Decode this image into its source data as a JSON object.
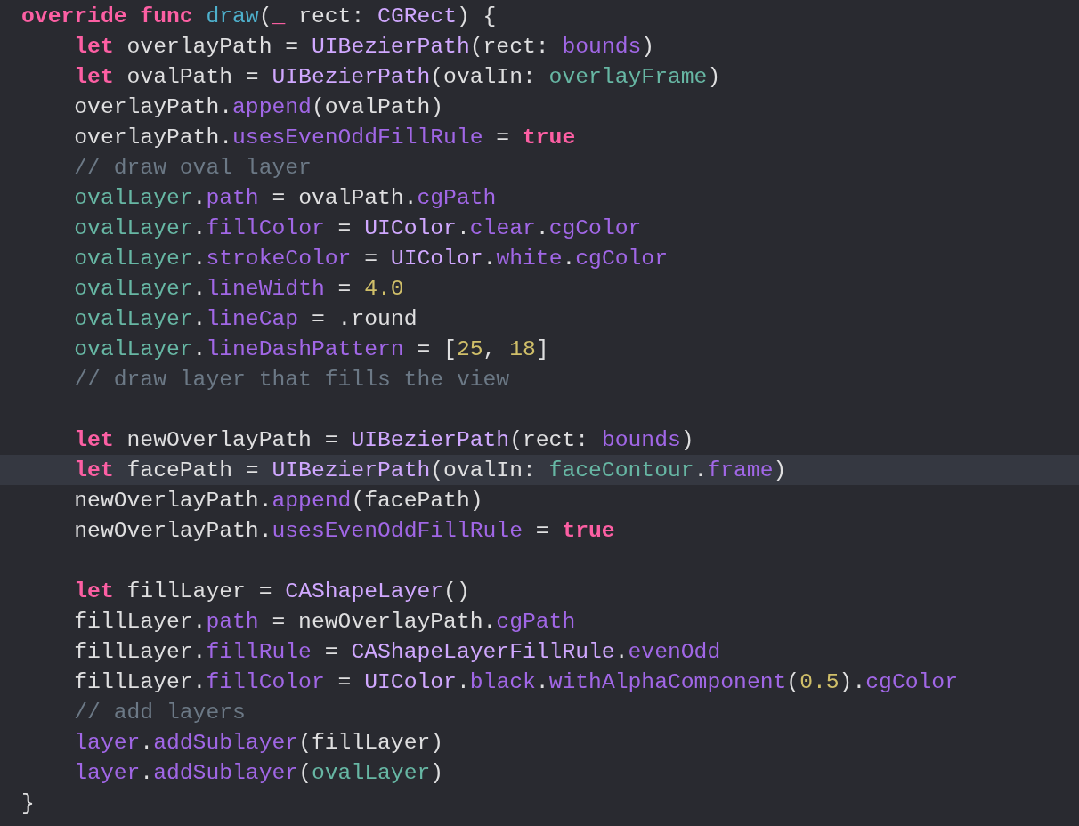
{
  "editor": {
    "lines": [
      {
        "current": false,
        "tokens": [
          {
            "text": "override func ",
            "kind": "keyword"
          },
          {
            "text": "draw",
            "kind": "decl"
          },
          {
            "text": "(",
            "kind": "plain"
          },
          {
            "text": "_",
            "kind": "keyword"
          },
          {
            "text": " rect: ",
            "kind": "plain"
          },
          {
            "text": "CGRect",
            "kind": "type"
          },
          {
            "text": ") {",
            "kind": "plain"
          }
        ],
        "children": [
          {
            "current": false,
            "tokens": [
              {
                "text": "let",
                "kind": "keyword"
              },
              {
                "text": " overlayPath = ",
                "kind": "plain"
              },
              {
                "text": "UIBezierPath",
                "kind": "type"
              },
              {
                "text": "(rect: ",
                "kind": "plain"
              },
              {
                "text": "bounds",
                "kind": "member"
              },
              {
                "text": ")",
                "kind": "plain"
              }
            ]
          },
          {
            "current": false,
            "tokens": [
              {
                "text": "let",
                "kind": "keyword"
              },
              {
                "text": " ovalPath = ",
                "kind": "plain"
              },
              {
                "text": "UIBezierPath",
                "kind": "type"
              },
              {
                "text": "(ovalIn: ",
                "kind": "plain"
              },
              {
                "text": "overlayFrame",
                "kind": "project"
              },
              {
                "text": ")",
                "kind": "plain"
              }
            ]
          },
          {
            "current": false,
            "tokens": [
              {
                "text": "overlayPath.",
                "kind": "plain"
              },
              {
                "text": "append",
                "kind": "member"
              },
              {
                "text": "(ovalPath)",
                "kind": "plain"
              }
            ]
          },
          {
            "current": false,
            "tokens": [
              {
                "text": "overlayPath.",
                "kind": "plain"
              },
              {
                "text": "usesEvenOddFillRule",
                "kind": "member"
              },
              {
                "text": " = ",
                "kind": "plain"
              },
              {
                "text": "true",
                "kind": "keyword"
              }
            ]
          },
          {
            "current": false,
            "tokens": [
              {
                "text": "// draw oval layer",
                "kind": "comment"
              }
            ]
          },
          {
            "current": false,
            "tokens": [
              {
                "text": "ovalLayer",
                "kind": "project"
              },
              {
                "text": ".",
                "kind": "plain"
              },
              {
                "text": "path",
                "kind": "member"
              },
              {
                "text": " = ovalPath.",
                "kind": "plain"
              },
              {
                "text": "cgPath",
                "kind": "member"
              }
            ]
          },
          {
            "current": false,
            "tokens": [
              {
                "text": "ovalLayer",
                "kind": "project"
              },
              {
                "text": ".",
                "kind": "plain"
              },
              {
                "text": "fillColor",
                "kind": "member"
              },
              {
                "text": " = ",
                "kind": "plain"
              },
              {
                "text": "UIColor",
                "kind": "type"
              },
              {
                "text": ".",
                "kind": "plain"
              },
              {
                "text": "clear",
                "kind": "member"
              },
              {
                "text": ".",
                "kind": "plain"
              },
              {
                "text": "cgColor",
                "kind": "member"
              }
            ]
          },
          {
            "current": false,
            "tokens": [
              {
                "text": "ovalLayer",
                "kind": "project"
              },
              {
                "text": ".",
                "kind": "plain"
              },
              {
                "text": "strokeColor",
                "kind": "member"
              },
              {
                "text": " = ",
                "kind": "plain"
              },
              {
                "text": "UIColor",
                "kind": "type"
              },
              {
                "text": ".",
                "kind": "plain"
              },
              {
                "text": "white",
                "kind": "member"
              },
              {
                "text": ".",
                "kind": "plain"
              },
              {
                "text": "cgColor",
                "kind": "member"
              }
            ]
          },
          {
            "current": false,
            "tokens": [
              {
                "text": "ovalLayer",
                "kind": "project"
              },
              {
                "text": ".",
                "kind": "plain"
              },
              {
                "text": "lineWidth",
                "kind": "member"
              },
              {
                "text": " = ",
                "kind": "plain"
              },
              {
                "text": "4.0",
                "kind": "number"
              }
            ]
          },
          {
            "current": false,
            "tokens": [
              {
                "text": "ovalLayer",
                "kind": "project"
              },
              {
                "text": ".",
                "kind": "plain"
              },
              {
                "text": "lineCap",
                "kind": "member"
              },
              {
                "text": " = .round",
                "kind": "plain"
              }
            ]
          },
          {
            "current": false,
            "tokens": [
              {
                "text": "ovalLayer",
                "kind": "project"
              },
              {
                "text": ".",
                "kind": "plain"
              },
              {
                "text": "lineDashPattern",
                "kind": "member"
              },
              {
                "text": " = [",
                "kind": "plain"
              },
              {
                "text": "25",
                "kind": "number"
              },
              {
                "text": ", ",
                "kind": "plain"
              },
              {
                "text": "18",
                "kind": "number"
              },
              {
                "text": "]",
                "kind": "plain"
              }
            ]
          },
          {
            "current": false,
            "tokens": [
              {
                "text": "// draw layer that fills the view",
                "kind": "comment"
              }
            ]
          },
          {
            "current": false
          },
          {
            "current": false,
            "tokens": [
              {
                "text": "let",
                "kind": "keyword"
              },
              {
                "text": " newOverlayPath = ",
                "kind": "plain"
              },
              {
                "text": "UIBezierPath",
                "kind": "type"
              },
              {
                "text": "(rect: ",
                "kind": "plain"
              },
              {
                "text": "bounds",
                "kind": "member"
              },
              {
                "text": ")",
                "kind": "plain"
              }
            ]
          },
          {
            "current": true,
            "tokens": [
              {
                "text": "let",
                "kind": "keyword"
              },
              {
                "text": " facePath = ",
                "kind": "plain"
              },
              {
                "text": "UIBezierPath",
                "kind": "type"
              },
              {
                "text": "(ovalIn: ",
                "kind": "plain"
              },
              {
                "text": "faceContour",
                "kind": "project"
              },
              {
                "text": ".",
                "kind": "plain"
              },
              {
                "text": "frame",
                "kind": "member"
              },
              {
                "text": ")",
                "kind": "plain"
              }
            ]
          },
          {
            "current": false,
            "tokens": [
              {
                "text": "newOverlayPath.",
                "kind": "plain"
              },
              {
                "text": "append",
                "kind": "member"
              },
              {
                "text": "(facePath)",
                "kind": "plain"
              }
            ]
          },
          {
            "current": false,
            "tokens": [
              {
                "text": "newOverlayPath.",
                "kind": "plain"
              },
              {
                "text": "usesEvenOddFillRule",
                "kind": "member"
              },
              {
                "text": " = ",
                "kind": "plain"
              },
              {
                "text": "true",
                "kind": "keyword"
              }
            ]
          },
          {
            "current": false
          },
          {
            "current": false,
            "tokens": [
              {
                "text": "let",
                "kind": "keyword"
              },
              {
                "text": " fillLayer = ",
                "kind": "plain"
              },
              {
                "text": "CAShapeLayer",
                "kind": "type"
              },
              {
                "text": "()",
                "kind": "plain"
              }
            ]
          },
          {
            "current": false,
            "tokens": [
              {
                "text": "fillLayer.",
                "kind": "plain"
              },
              {
                "text": "path",
                "kind": "member"
              },
              {
                "text": " = newOverlayPath.",
                "kind": "plain"
              },
              {
                "text": "cgPath",
                "kind": "member"
              }
            ]
          },
          {
            "current": false,
            "tokens": [
              {
                "text": "fillLayer.",
                "kind": "plain"
              },
              {
                "text": "fillRule",
                "kind": "member"
              },
              {
                "text": " = ",
                "kind": "plain"
              },
              {
                "text": "CAShapeLayerFillRule",
                "kind": "type"
              },
              {
                "text": ".",
                "kind": "plain"
              },
              {
                "text": "evenOdd",
                "kind": "member"
              }
            ]
          },
          {
            "current": false,
            "tokens": [
              {
                "text": "fillLayer.",
                "kind": "plain"
              },
              {
                "text": "fillColor",
                "kind": "member"
              },
              {
                "text": " = ",
                "kind": "plain"
              },
              {
                "text": "UIColor",
                "kind": "type"
              },
              {
                "text": ".",
                "kind": "plain"
              },
              {
                "text": "black",
                "kind": "member"
              },
              {
                "text": ".",
                "kind": "plain"
              },
              {
                "text": "withAlphaComponent",
                "kind": "member"
              },
              {
                "text": "(",
                "kind": "plain"
              },
              {
                "text": "0.5",
                "kind": "number"
              },
              {
                "text": ").",
                "kind": "plain"
              },
              {
                "text": "cgColor",
                "kind": "member"
              }
            ]
          },
          {
            "current": false,
            "tokens": [
              {
                "text": "// add layers",
                "kind": "comment"
              }
            ]
          },
          {
            "current": false,
            "tokens": [
              {
                "text": "layer",
                "kind": "member"
              },
              {
                "text": ".",
                "kind": "plain"
              },
              {
                "text": "addSublayer",
                "kind": "member"
              },
              {
                "text": "(fillLayer)",
                "kind": "plain"
              }
            ]
          },
          {
            "current": false,
            "tokens": [
              {
                "text": "layer",
                "kind": "member"
              },
              {
                "text": ".",
                "kind": "plain"
              },
              {
                "text": "addSublayer",
                "kind": "member"
              },
              {
                "text": "(",
                "kind": "plain"
              },
              {
                "text": "ovalLayer",
                "kind": "project"
              },
              {
                "text": ")",
                "kind": "plain"
              }
            ]
          }
        ]
      },
      {
        "current": false,
        "tokens": [
          {
            "text": "}",
            "kind": "plain"
          }
        ]
      }
    ]
  }
}
